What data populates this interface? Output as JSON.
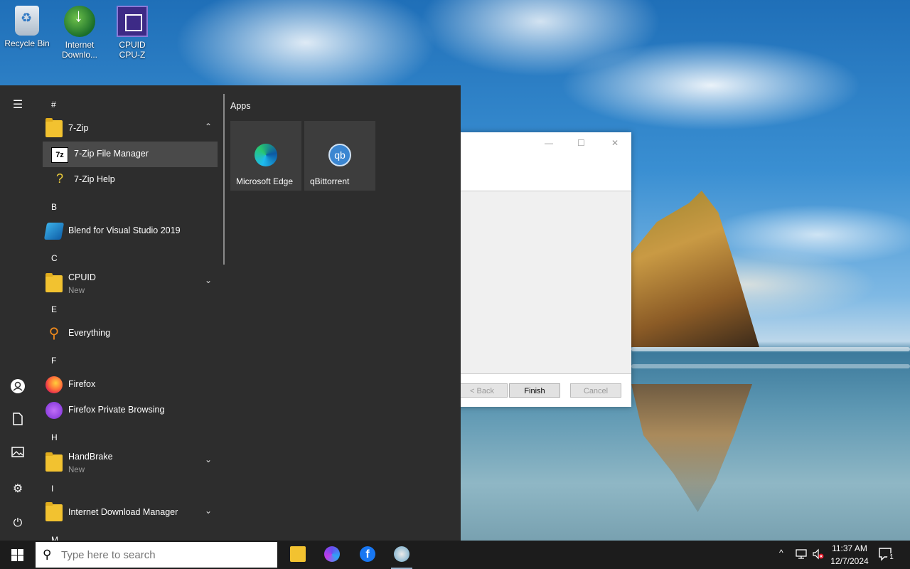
{
  "desktop": {
    "icons": [
      {
        "label": "Recycle Bin",
        "icon": "recycle-bin-icon"
      },
      {
        "label": "Internet\nDownlo...",
        "icon": "internet-download-manager-icon"
      },
      {
        "label": "CPUID\nCPU-Z",
        "icon": "cpu-z-icon"
      }
    ]
  },
  "dialog": {
    "buttons": {
      "back": "< Back",
      "finish": "Finish",
      "cancel": "Cancel"
    }
  },
  "start_menu": {
    "rail_icons": [
      "hamburger-menu-icon",
      "user-account-icon",
      "documents-icon",
      "pictures-icon",
      "settings-icon",
      "power-icon"
    ],
    "groups": [
      {
        "letter": "#"
      },
      {
        "letter": "B"
      },
      {
        "letter": "C"
      },
      {
        "letter": "E"
      },
      {
        "letter": "F"
      },
      {
        "letter": "H"
      },
      {
        "letter": "I"
      },
      {
        "letter": "M"
      }
    ],
    "apps": {
      "seven_zip": {
        "label": "7-Zip"
      },
      "seven_zip_fm": {
        "label": "7-Zip File Manager"
      },
      "seven_zip_help": {
        "label": "7-Zip Help"
      },
      "blend": {
        "label": "Blend for Visual Studio 2019"
      },
      "cpuid": {
        "label": "CPUID",
        "badge": "New"
      },
      "everything": {
        "label": "Everything"
      },
      "firefox": {
        "label": "Firefox"
      },
      "firefox_private": {
        "label": "Firefox Private Browsing"
      },
      "handbrake": {
        "label": "HandBrake",
        "badge": "New"
      },
      "idm": {
        "label": "Internet Download Manager"
      }
    },
    "tiles_header": "Apps",
    "tiles": [
      {
        "label": "Microsoft Edge",
        "icon": "microsoft-edge-icon"
      },
      {
        "label": "qBittorrent",
        "icon": "qbittorrent-icon",
        "glyph": "qb"
      }
    ]
  },
  "taskbar": {
    "search": {
      "placeholder": "Type here to search"
    },
    "pinned": [
      "file-explorer-icon",
      "bing-app-icon",
      "facebook-icon",
      "installer-app-icon"
    ],
    "clock": {
      "time": "11:37 AM",
      "date": "12/7/2024"
    },
    "notification_count": "1"
  },
  "colors": {
    "start_bg": "#2d2d2d",
    "highlight": "#4a4a4a",
    "taskbar_bg": "#1c1c1c"
  }
}
